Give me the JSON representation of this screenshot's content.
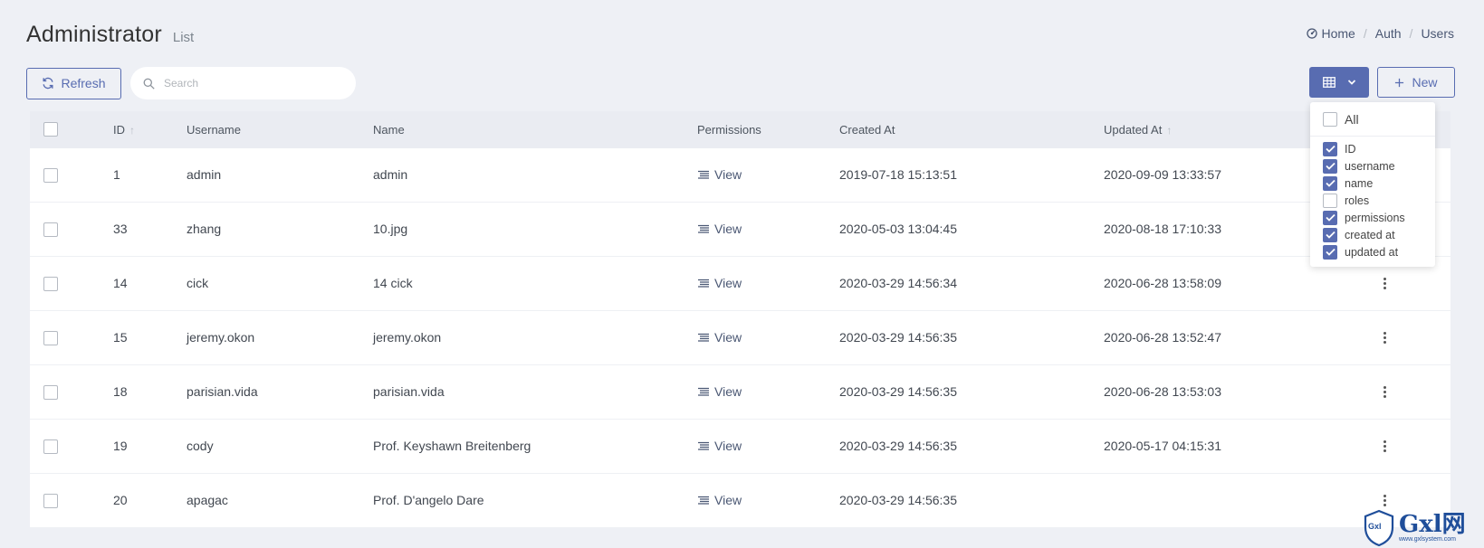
{
  "header": {
    "title": "Administrator",
    "subtitle": "List"
  },
  "breadcrumb": {
    "home": "Home",
    "auth": "Auth",
    "users": "Users"
  },
  "toolbar": {
    "refresh_label": "Refresh",
    "search_placeholder": "Search",
    "new_label": "New"
  },
  "table": {
    "headers": {
      "id": "ID",
      "username": "Username",
      "name": "Name",
      "permissions": "Permissions",
      "created_at": "Created At",
      "updated_at": "Updated At"
    },
    "rows": [
      {
        "id": "1",
        "username": "admin",
        "name": "admin",
        "permissions": "View",
        "created_at": "2019-07-18 15:13:51",
        "updated_at": "2020-09-09 13:33:57"
      },
      {
        "id": "33",
        "username": "zhang",
        "name": "10.jpg",
        "permissions": "View",
        "created_at": "2020-05-03 13:04:45",
        "updated_at": "2020-08-18 17:10:33"
      },
      {
        "id": "14",
        "username": "cick",
        "name": "14 cick",
        "permissions": "View",
        "created_at": "2020-03-29 14:56:34",
        "updated_at": "2020-06-28 13:58:09"
      },
      {
        "id": "15",
        "username": "jeremy.okon",
        "name": "jeremy.okon",
        "permissions": "View",
        "created_at": "2020-03-29 14:56:35",
        "updated_at": "2020-06-28 13:52:47"
      },
      {
        "id": "18",
        "username": "parisian.vida",
        "name": "parisian.vida",
        "permissions": "View",
        "created_at": "2020-03-29 14:56:35",
        "updated_at": "2020-06-28 13:53:03"
      },
      {
        "id": "19",
        "username": "cody",
        "name": "Prof. Keyshawn Breitenberg",
        "permissions": "View",
        "created_at": "2020-03-29 14:56:35",
        "updated_at": "2020-05-17 04:15:31"
      },
      {
        "id": "20",
        "username": "apagac",
        "name": "Prof. D'angelo Dare",
        "permissions": "View",
        "created_at": "2020-03-29 14:56:35",
        "updated_at": ""
      }
    ]
  },
  "column_selector": {
    "all": {
      "label": "All",
      "checked": false
    },
    "columns": [
      {
        "label": "ID",
        "checked": true
      },
      {
        "label": "username",
        "checked": true
      },
      {
        "label": "name",
        "checked": true
      },
      {
        "label": "roles",
        "checked": false
      },
      {
        "label": "permissions",
        "checked": true
      },
      {
        "label": "created at",
        "checked": true
      },
      {
        "label": "updated at",
        "checked": true
      }
    ]
  },
  "watermark": {
    "text": "Gxl网",
    "sub": "www.gxlsystem.com",
    "badge": "Gxl"
  },
  "colors": {
    "primary": "#586cb1",
    "background": "#eef0f5",
    "header_row": "#eaecf2"
  },
  "icons": [
    "home-icon",
    "refresh-icon",
    "search-icon",
    "table-grid-icon",
    "chevron-down-icon",
    "plus-icon",
    "list-icon",
    "more-vertical-icon",
    "sort-arrow-icon",
    "checkbox-icon"
  ]
}
